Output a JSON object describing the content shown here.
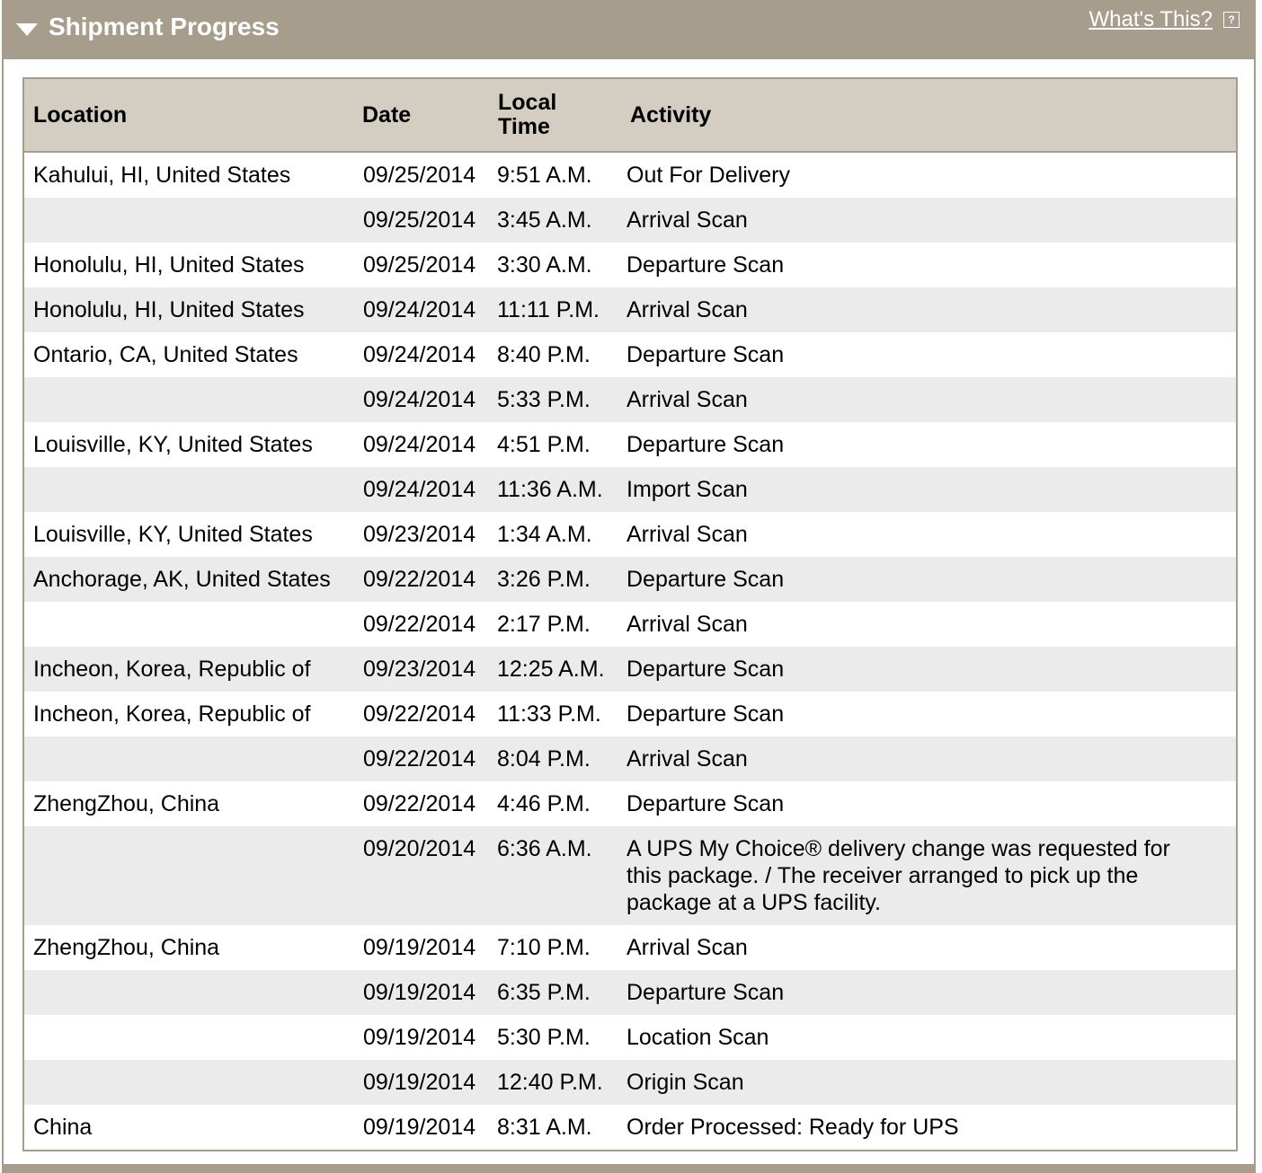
{
  "panel": {
    "title": "Shipment Progress",
    "whats_this_label": "What's This?",
    "help_icon_glyph": "?"
  },
  "table": {
    "headers": {
      "location": "Location",
      "date": "Date",
      "time": "Local Time",
      "activity": "Activity"
    },
    "rows": [
      {
        "location": "Kahului, HI, United States",
        "date": "09/25/2014",
        "time": "9:51 A.M.",
        "activity": "Out For Delivery"
      },
      {
        "location": "",
        "date": "09/25/2014",
        "time": "3:45 A.M.",
        "activity": "Arrival Scan"
      },
      {
        "location": "Honolulu, HI, United States",
        "date": "09/25/2014",
        "time": "3:30 A.M.",
        "activity": "Departure Scan"
      },
      {
        "location": "Honolulu, HI, United States",
        "date": "09/24/2014",
        "time": "11:11 P.M.",
        "activity": "Arrival Scan"
      },
      {
        "location": "Ontario, CA, United States",
        "date": "09/24/2014",
        "time": "8:40 P.M.",
        "activity": "Departure Scan"
      },
      {
        "location": "",
        "date": "09/24/2014",
        "time": "5:33 P.M.",
        "activity": "Arrival Scan"
      },
      {
        "location": "Louisville, KY, United States",
        "date": "09/24/2014",
        "time": "4:51 P.M.",
        "activity": "Departure Scan"
      },
      {
        "location": "",
        "date": "09/24/2014",
        "time": "11:36 A.M.",
        "activity": "Import Scan"
      },
      {
        "location": "Louisville, KY, United States",
        "date": "09/23/2014",
        "time": "1:34 A.M.",
        "activity": "Arrival Scan"
      },
      {
        "location": "Anchorage, AK, United States",
        "date": "09/22/2014",
        "time": "3:26 P.M.",
        "activity": "Departure Scan"
      },
      {
        "location": "",
        "date": "09/22/2014",
        "time": "2:17 P.M.",
        "activity": "Arrival Scan"
      },
      {
        "location": "Incheon, Korea, Republic of",
        "date": "09/23/2014",
        "time": "12:25 A.M.",
        "activity": "Departure Scan"
      },
      {
        "location": "Incheon, Korea, Republic of",
        "date": "09/22/2014",
        "time": "11:33 P.M.",
        "activity": "Departure Scan"
      },
      {
        "location": "",
        "date": "09/22/2014",
        "time": "8:04 P.M.",
        "activity": "Arrival Scan"
      },
      {
        "location": "ZhengZhou, China",
        "date": "09/22/2014",
        "time": "4:46 P.M.",
        "activity": "Departure Scan"
      },
      {
        "location": "",
        "date": "09/20/2014",
        "time": "6:36 A.M.",
        "activity": "A UPS My Choice® delivery change was requested for this package. / The receiver arranged to pick up the package at a UPS facility."
      },
      {
        "location": "ZhengZhou, China",
        "date": "09/19/2014",
        "time": "7:10 P.M.",
        "activity": "Arrival Scan"
      },
      {
        "location": "",
        "date": "09/19/2014",
        "time": "6:35 P.M.",
        "activity": "Departure Scan"
      },
      {
        "location": "",
        "date": "09/19/2014",
        "time": "5:30 P.M.",
        "activity": "Location Scan"
      },
      {
        "location": "",
        "date": "09/19/2014",
        "time": "12:40 P.M.",
        "activity": "Origin Scan"
      },
      {
        "location": "China",
        "date": "09/19/2014",
        "time": "8:31 A.M.",
        "activity": "Order Processed: Ready for UPS"
      }
    ]
  },
  "colors": {
    "header_bar": "#a79d8c",
    "table_header": "#d4cdc1",
    "row_stripe": "#ebebeb"
  }
}
